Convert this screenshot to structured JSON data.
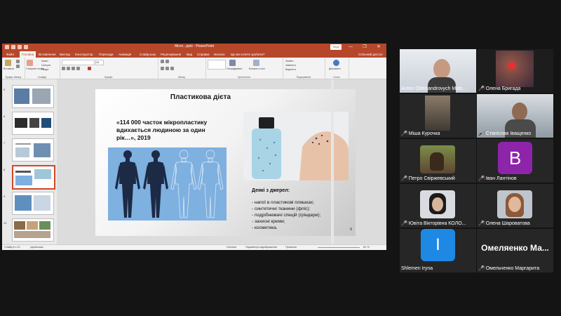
{
  "ppt": {
    "title": "Micro...pptx - PowerPoint",
    "signin": "Вхід",
    "tabs": [
      "Файл",
      "Головна",
      "Вставлення",
      "Вигляд",
      "Конструктор",
      "Переходи",
      "Анімація",
      "Слайд-шоу",
      "Рецензування",
      "Вид",
      "Справка",
      "Nexuno",
      "Що ви хочете зробити?"
    ],
    "active_tab": "Головна",
    "share": "Спільний доступ",
    "ribbon": {
      "groups": [
        "Буфер обміну",
        "Слайди",
        "Шрифт",
        "Абзац",
        "Креслення",
        "Редагування",
        "Голос"
      ],
      "paste": "Вставити",
      "new_slide": "Створити слайд",
      "layout": "Макет",
      "reset": "Скинути",
      "section": "Розділ",
      "arrange": "Упорядкувати",
      "quick_styles": "Експрес-стилі",
      "find": "Знайти",
      "replace": "Замінити",
      "select": "Виділити",
      "dictate": "Диктувати",
      "font_size": "18"
    },
    "slide_numbers": [
      "5",
      "6",
      "7",
      "8",
      "9",
      "10"
    ],
    "slide": {
      "title": "Пластикова дієта",
      "quote": "«114 000 часток мікропластику вдихається людиною за один рік…», 2019",
      "sources_title": "Деякі з джерел:",
      "sources": [
        "- напої в пластикові пляшках;",
        "- синтетичні тканини (фліс);",
        "- подрібнювачі спецій (гріндери);",
        "- захисні креми;",
        "- косметика."
      ],
      "number": "8"
    },
    "status": {
      "slide_of": "Слайд 8 з 10",
      "lang": "українська",
      "notes": "Нотатки",
      "comments": "Примітки",
      "view": "Параметри відображення",
      "present": "Примітки",
      "zoom": "62 %"
    }
  },
  "participants": [
    {
      "name": "Anton Oleksandrovych Mats...",
      "type": "video",
      "muted": false,
      "highlight": true
    },
    {
      "name": "Олена Бригада",
      "type": "video",
      "muted": true
    },
    {
      "name": "Міша Курочка",
      "type": "video",
      "muted": true
    },
    {
      "name": "Станіслав Іващенко",
      "type": "video",
      "muted": true
    },
    {
      "name": "Петро Свіржевський",
      "type": "avatar",
      "muted": true
    },
    {
      "name": "Іван Лантінов",
      "type": "letter",
      "letter": "B",
      "color": "#8e24aa",
      "muted": true
    },
    {
      "name": "Ювіта Вікторівна КОЛО...",
      "type": "avatar",
      "muted": true
    },
    {
      "name": "Олена Шароватова",
      "type": "avatar",
      "muted": true
    },
    {
      "name": "Shlemen Iryna",
      "type": "letter",
      "letter": "I",
      "color": "#1e88e5",
      "muted": false
    },
    {
      "name": "Омельченко Маргарита",
      "type": "text",
      "display": "Омеляенко Ма...",
      "muted": true
    }
  ],
  "colors": {
    "ppt_red": "#b7472a",
    "active_speaker": "#22c55e",
    "muted": "#e53935"
  }
}
